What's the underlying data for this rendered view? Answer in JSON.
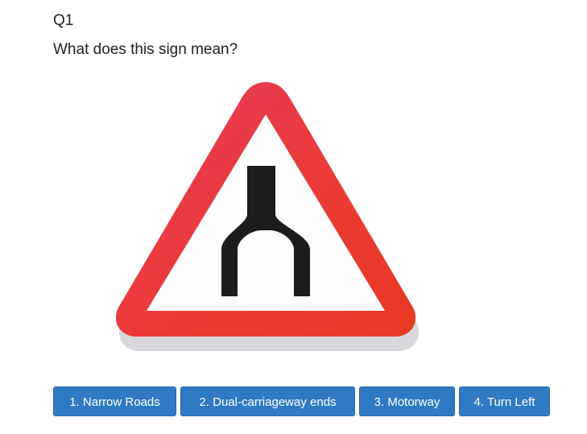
{
  "question": {
    "number": "Q1",
    "text": "What does this sign mean?"
  },
  "sign": {
    "icon": "dual-carriageway-ends-sign",
    "border_color": "#e8323a",
    "background_color": "#ffffff",
    "symbol_color": "#1c1c1c"
  },
  "answers": [
    {
      "label": "1. Narrow Roads"
    },
    {
      "label": "2. Dual-carriageway ends"
    },
    {
      "label": "3. Motorway"
    },
    {
      "label": "4. Turn Left"
    }
  ],
  "colors": {
    "button_bg": "#2f7ac2",
    "button_text": "#ffffff"
  }
}
